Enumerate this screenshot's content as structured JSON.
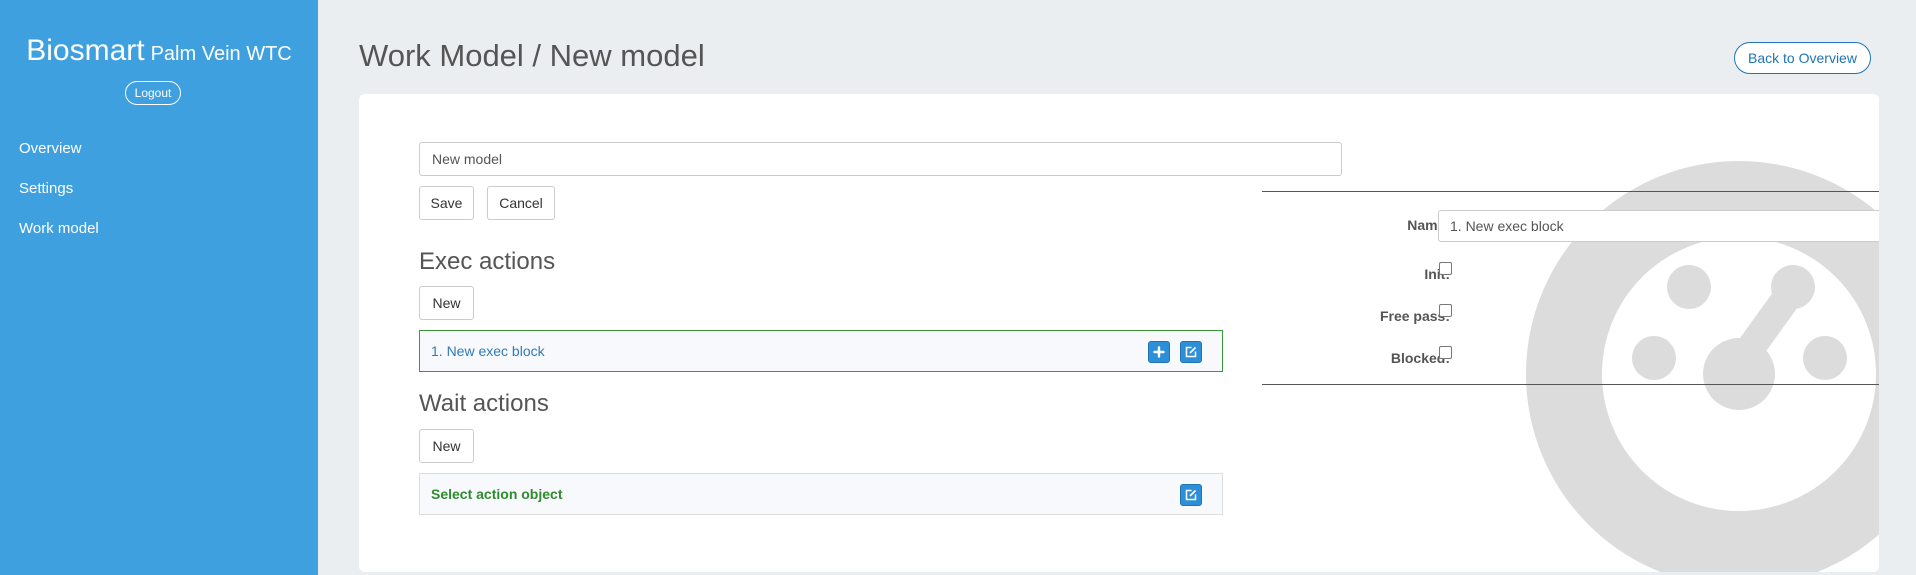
{
  "sidebar": {
    "brand_main": "Biosmart",
    "brand_sub": "Palm Vein WTC",
    "logout_label": "Logout",
    "nav": [
      {
        "label": "Overview"
      },
      {
        "label": "Settings"
      },
      {
        "label": "Work model"
      }
    ]
  },
  "header": {
    "title": "Work Model / New model",
    "back_label": "Back to Overview"
  },
  "form": {
    "model_name_value": "New model",
    "save_label": "Save",
    "cancel_label": "Cancel"
  },
  "exec_actions": {
    "title": "Exec actions",
    "new_label": "New",
    "blocks": [
      {
        "label": "1. New exec block"
      }
    ]
  },
  "wait_actions": {
    "title": "Wait actions",
    "new_label": "New",
    "select_label": "Select action object"
  },
  "properties": {
    "name_label": "Name:",
    "name_value": "1. New exec block",
    "init_label": "Init:",
    "init_checked": false,
    "free_pass_label": "Free pass:",
    "free_pass_checked": false,
    "blocked_label": "Blocked:",
    "blocked_checked": false
  },
  "icons": {
    "add": "plus-icon",
    "edit": "edit-icon",
    "watermark": "gauge-icon"
  },
  "colors": {
    "sidebar_bg": "#3fa0e0",
    "accent": "#2d8fd8",
    "active_border": "#3a9a3a",
    "link": "#337ab7"
  }
}
